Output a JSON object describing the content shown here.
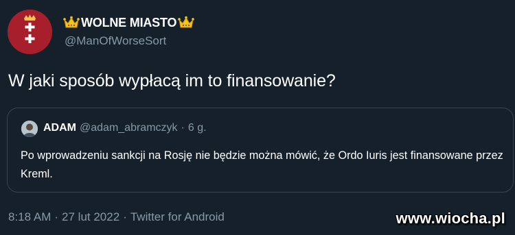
{
  "tweet": {
    "author": {
      "display_name": "WOLNE MIASTO",
      "handle": "@ManOfWorseSort",
      "name_decoration_icon": "crown-emoji",
      "avatar_icon": "gdansk-coat-of-arms"
    },
    "text": "W jaki sposób wypłacą im to finansowanie?",
    "quoted_tweet": {
      "author_name": "ADAM",
      "author_handle": "@adam_abramczyk",
      "separator": "·",
      "time_ago": "6 g.",
      "text": "Po wprowadzeniu sankcji na Rosję nie będzie można mówić, że Ordo Iuris jest finansowane przez Kreml."
    },
    "footer": {
      "time": "8:18 AM",
      "separator_1": "·",
      "date": "27 lut 2022",
      "separator_2": "·",
      "source": "Twitter for Android"
    }
  },
  "watermark": "www.wiocha.pl",
  "colors": {
    "background": "#15202b",
    "primary_text": "#ffffff",
    "secondary_text": "#8899a6",
    "border": "#38444d",
    "avatar_red": "#a61f2a",
    "crown_gold": "#f5c518"
  }
}
